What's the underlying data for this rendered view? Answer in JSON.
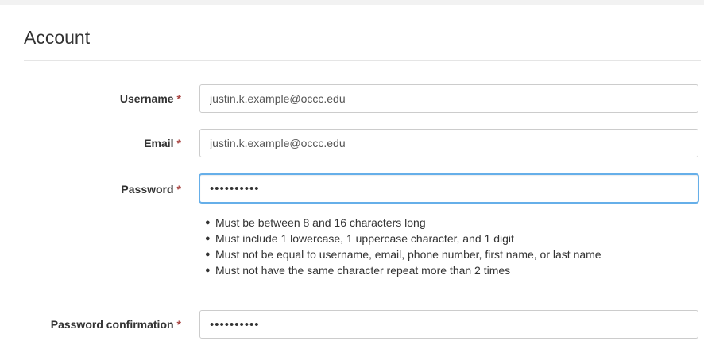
{
  "section": {
    "title": "Account"
  },
  "form": {
    "required_marker": "*",
    "username": {
      "label": "Username",
      "value": "justin.k.example@occc.edu"
    },
    "email": {
      "label": "Email",
      "value": "justin.k.example@occc.edu"
    },
    "password": {
      "label": "Password",
      "value": "••••••••••"
    },
    "password_rules": [
      "Must be between 8 and 16 characters long",
      "Must include 1 lowercase, 1 uppercase character, and 1 digit",
      "Must not be equal to username, email, phone number, first name, or last name",
      "Must not have the same character repeat more than 2 times"
    ],
    "password_confirmation": {
      "label": "Password confirmation",
      "value": "••••••••••"
    }
  },
  "colors": {
    "required": "#a94442",
    "focus_border": "#66afe9"
  }
}
